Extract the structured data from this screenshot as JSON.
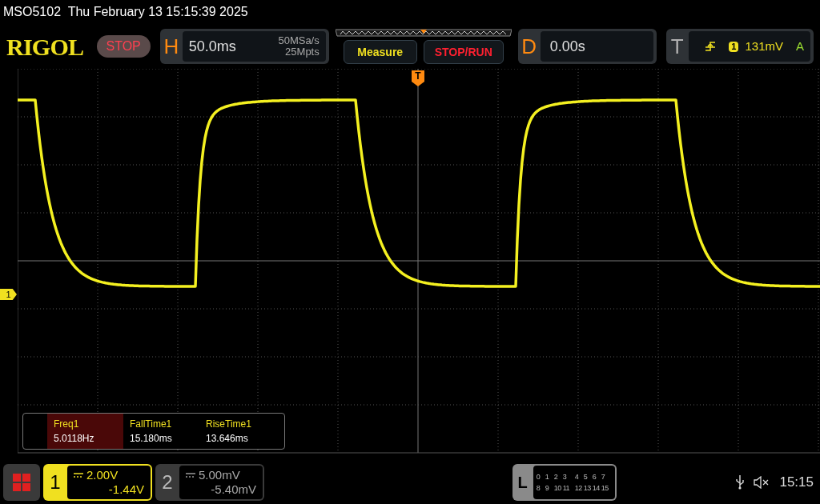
{
  "title_bar": {
    "text": "MSO5102  Thu February 13 15:15:39 2025"
  },
  "toolbar": {
    "logo": "RIGOL",
    "run_state": "STOP",
    "horizontal": {
      "label": "H",
      "timebase": "50.0ms",
      "sample_rate": "50MSa/s",
      "memory_depth": "25Mpts"
    },
    "buttons": [
      {
        "label": "Measure",
        "kind": "menu"
      },
      {
        "label": "STOP/RUN",
        "kind": "run"
      }
    ],
    "delay": {
      "label": "D",
      "value": "0.00s"
    },
    "trigger": {
      "label": "T",
      "source": "1",
      "level": "131mV",
      "mode": "A"
    }
  },
  "screen": {
    "channel_marker": "1",
    "trigger_marker": "T",
    "measurements": [
      {
        "name": "Freq1",
        "value": "5.0118Hz",
        "selected": true
      },
      {
        "name": "FallTime1",
        "value": "15.180ms",
        "selected": false
      },
      {
        "name": "RiseTime1",
        "value": "13.646ms",
        "selected": false
      }
    ]
  },
  "bottom_bar": {
    "channels": [
      {
        "number": "1",
        "scale": "2.00V",
        "offset": "-1.44V",
        "selected": true
      },
      {
        "number": "2",
        "scale": "5.00mV",
        "offset": "-5.40mV",
        "selected": false
      }
    ],
    "logic": {
      "label": "L",
      "rows": [
        [
          "0",
          "1",
          "2",
          "3",
          "4",
          "5",
          "6",
          "7"
        ],
        [
          "8",
          "9",
          "10",
          "11",
          "12",
          "13",
          "14",
          "15"
        ]
      ]
    },
    "time": "15:15"
  }
}
